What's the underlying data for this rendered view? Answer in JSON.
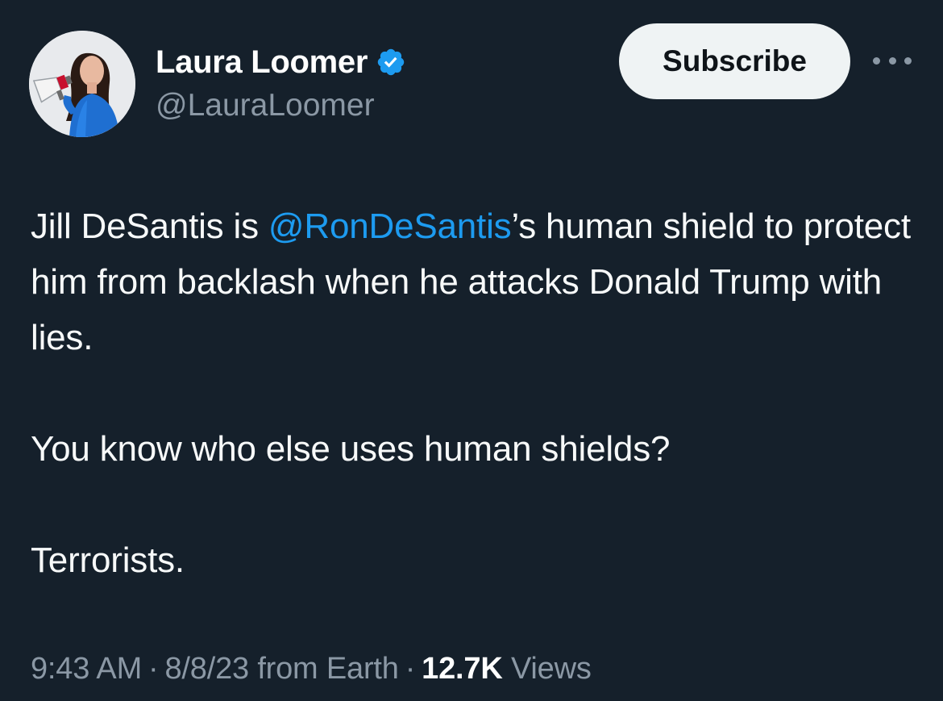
{
  "author": {
    "display_name": "Laura Loomer",
    "handle": "@LauraLoomer",
    "verified_icon": "verified-badge-icon",
    "avatar_icon": "avatar"
  },
  "actions": {
    "subscribe_label": "Subscribe",
    "more_icon": "more-horizontal-icon"
  },
  "tweet": {
    "line1_pre": "Jill DeSantis is ",
    "mention": "@RonDeSantis",
    "line1_post": "’s human shield to protect him from backlash when he attacks Donald Trump with lies.",
    "paragraph2": "You know who else uses human shields?",
    "paragraph3": "Terrorists."
  },
  "meta": {
    "time": "9:43 AM",
    "separator": "·",
    "date": "8/8/23",
    "source": "from Earth",
    "views_count": "12.7K",
    "views_label": "Views"
  },
  "colors": {
    "background": "#15202b",
    "accent": "#1d9bf0",
    "secondary_text": "#8b98a5"
  }
}
